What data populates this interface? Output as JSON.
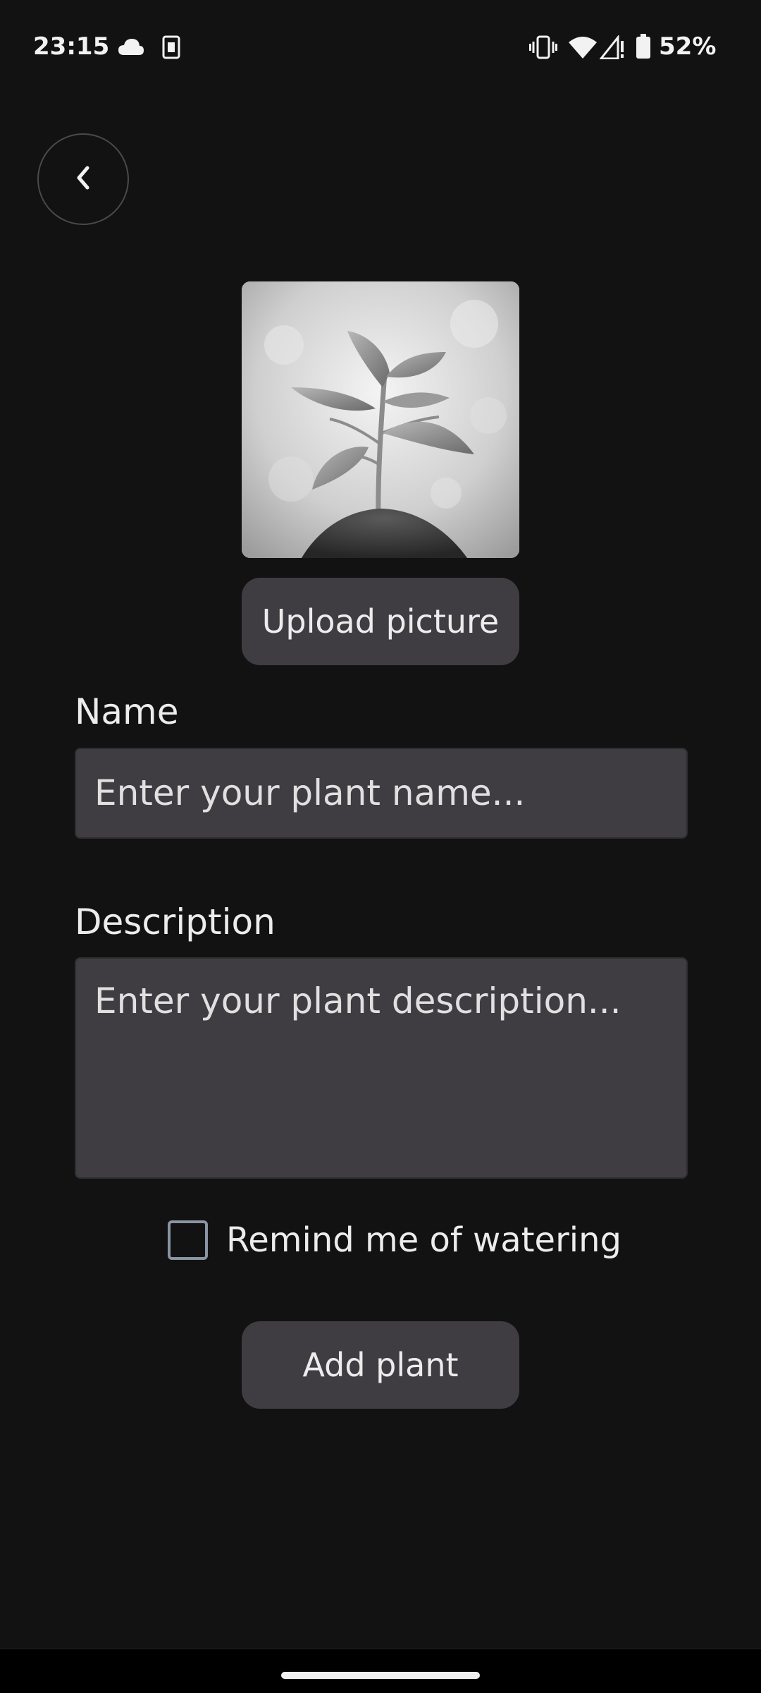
{
  "status_bar": {
    "time": "23:15",
    "battery": "52%",
    "icons_left": [
      "cloud-icon",
      "sim-card-icon"
    ],
    "icons_right": [
      "vibrate-icon",
      "wifi-icon",
      "signal-icon",
      "battery-icon"
    ]
  },
  "header": {
    "back_icon": "chevron-left-icon"
  },
  "form": {
    "upload_button": "Upload picture",
    "name_label": "Name",
    "name_placeholder": "Enter your plant name...",
    "description_label": "Description",
    "description_placeholder": "Enter your plant description...",
    "reminder_label": "Remind me of watering",
    "reminder_checked": false,
    "submit_button": "Add plant"
  },
  "colors": {
    "background": "#121212",
    "surface": "#3f3d41",
    "text": "#ececec",
    "checkbox_border": "#8a94a3"
  }
}
